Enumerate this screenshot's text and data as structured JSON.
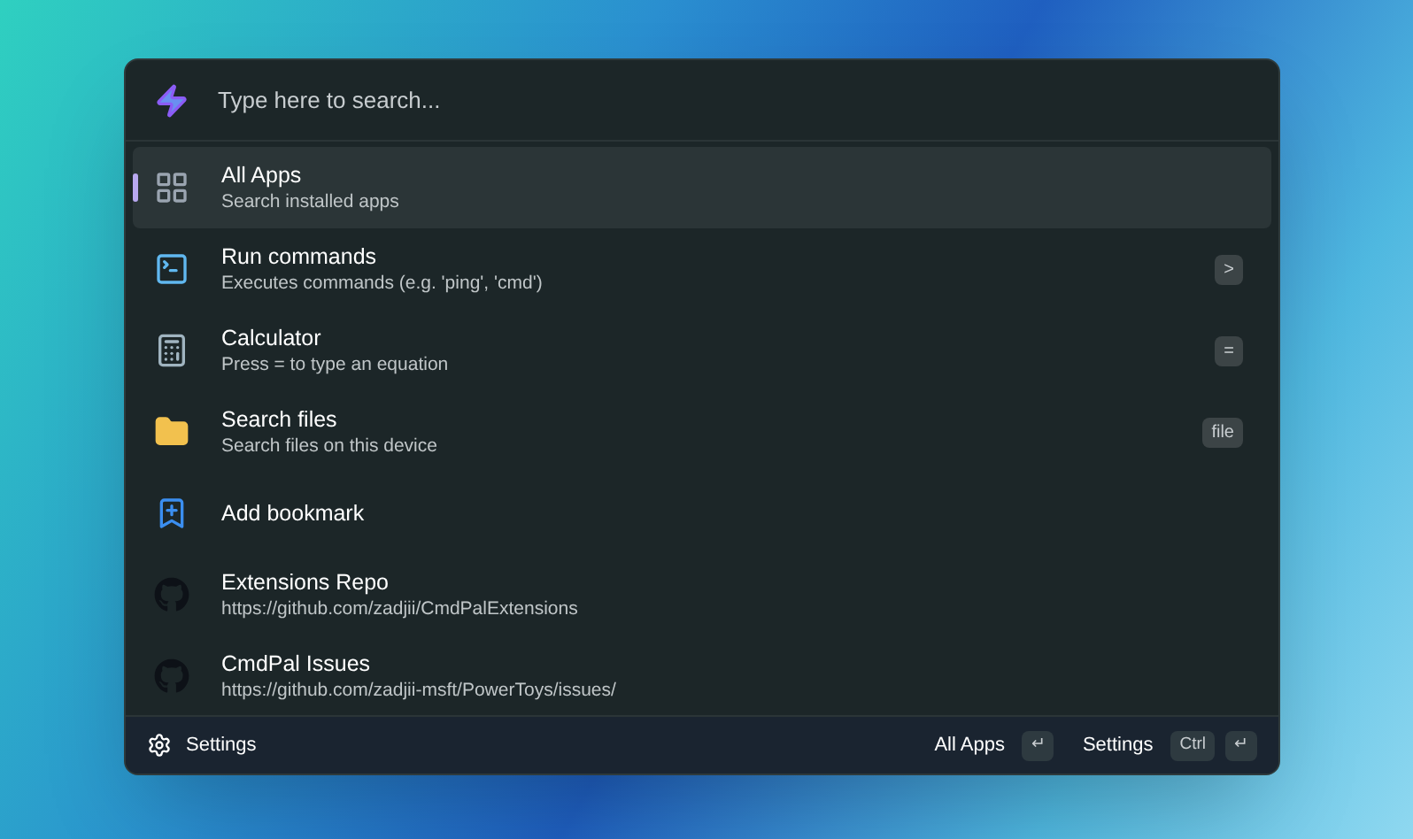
{
  "search": {
    "placeholder": "Type here to search..."
  },
  "items": [
    {
      "kind": "apps",
      "title": "All Apps",
      "subtitle": "Search installed apps",
      "selected": true
    },
    {
      "kind": "terminal",
      "title": "Run commands",
      "subtitle": "Executes commands (e.g. 'ping', 'cmd')",
      "shortcut": ">",
      "selected": false
    },
    {
      "kind": "calculator",
      "title": "Calculator",
      "subtitle": "Press = to type an equation",
      "shortcut": "=",
      "selected": false
    },
    {
      "kind": "folder",
      "title": "Search files",
      "subtitle": "Search files on this device",
      "shortcut": "file",
      "selected": false
    },
    {
      "kind": "bookmark",
      "title": "Add bookmark",
      "selected": false
    },
    {
      "kind": "github",
      "title": "Extensions Repo",
      "subtitle": "https://github.com/zadjii/CmdPalExtensions",
      "selected": false
    },
    {
      "kind": "github",
      "title": "CmdPal Issues",
      "subtitle": "https://github.com/zadjii-msft/PowerToys/issues/",
      "selected": false
    }
  ],
  "footer": {
    "settings": "Settings",
    "actions": [
      {
        "label": "All Apps",
        "keys": [
          "↵"
        ]
      },
      {
        "label": "Settings",
        "keys": [
          "Ctrl",
          "↵"
        ]
      }
    ]
  }
}
